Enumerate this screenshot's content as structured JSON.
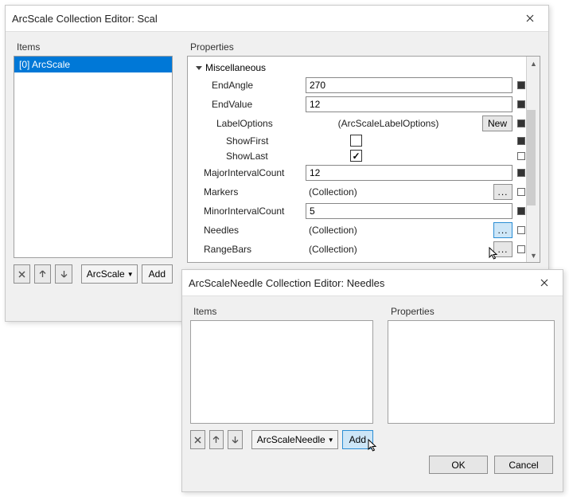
{
  "dialog1": {
    "title": "ArcScale Collection Editor: Scal",
    "items_label": "Items",
    "props_label": "Properties",
    "items": [
      "[0] ArcScale"
    ],
    "dropdown": "ArcScale",
    "add": "Add",
    "group": "Miscellaneous",
    "rows": {
      "endangle_label": "EndAngle",
      "endangle_value": "270",
      "endvalue_label": "EndValue",
      "endvalue_value": "12",
      "labeloptions_label": "LabelOptions",
      "labeloptions_value": "(ArcScaleLabelOptions)",
      "new": "New",
      "showfirst_label": "ShowFirst",
      "showlast_label": "ShowLast",
      "majorint_label": "MajorIntervalCount",
      "majorint_value": "12",
      "markers_label": "Markers",
      "markers_value": "(Collection)",
      "minorint_label": "MinorIntervalCount",
      "minorint_value": "5",
      "needles_label": "Needles",
      "needles_value": "(Collection)",
      "rangebars_label": "RangeBars",
      "rangebars_value": "(Collection)"
    }
  },
  "dialog2": {
    "title": "ArcScaleNeedle Collection Editor: Needles",
    "items_label": "Items",
    "props_label": "Properties",
    "dropdown": "ArcScaleNeedle",
    "add": "Add",
    "ok": "OK",
    "cancel": "Cancel"
  }
}
